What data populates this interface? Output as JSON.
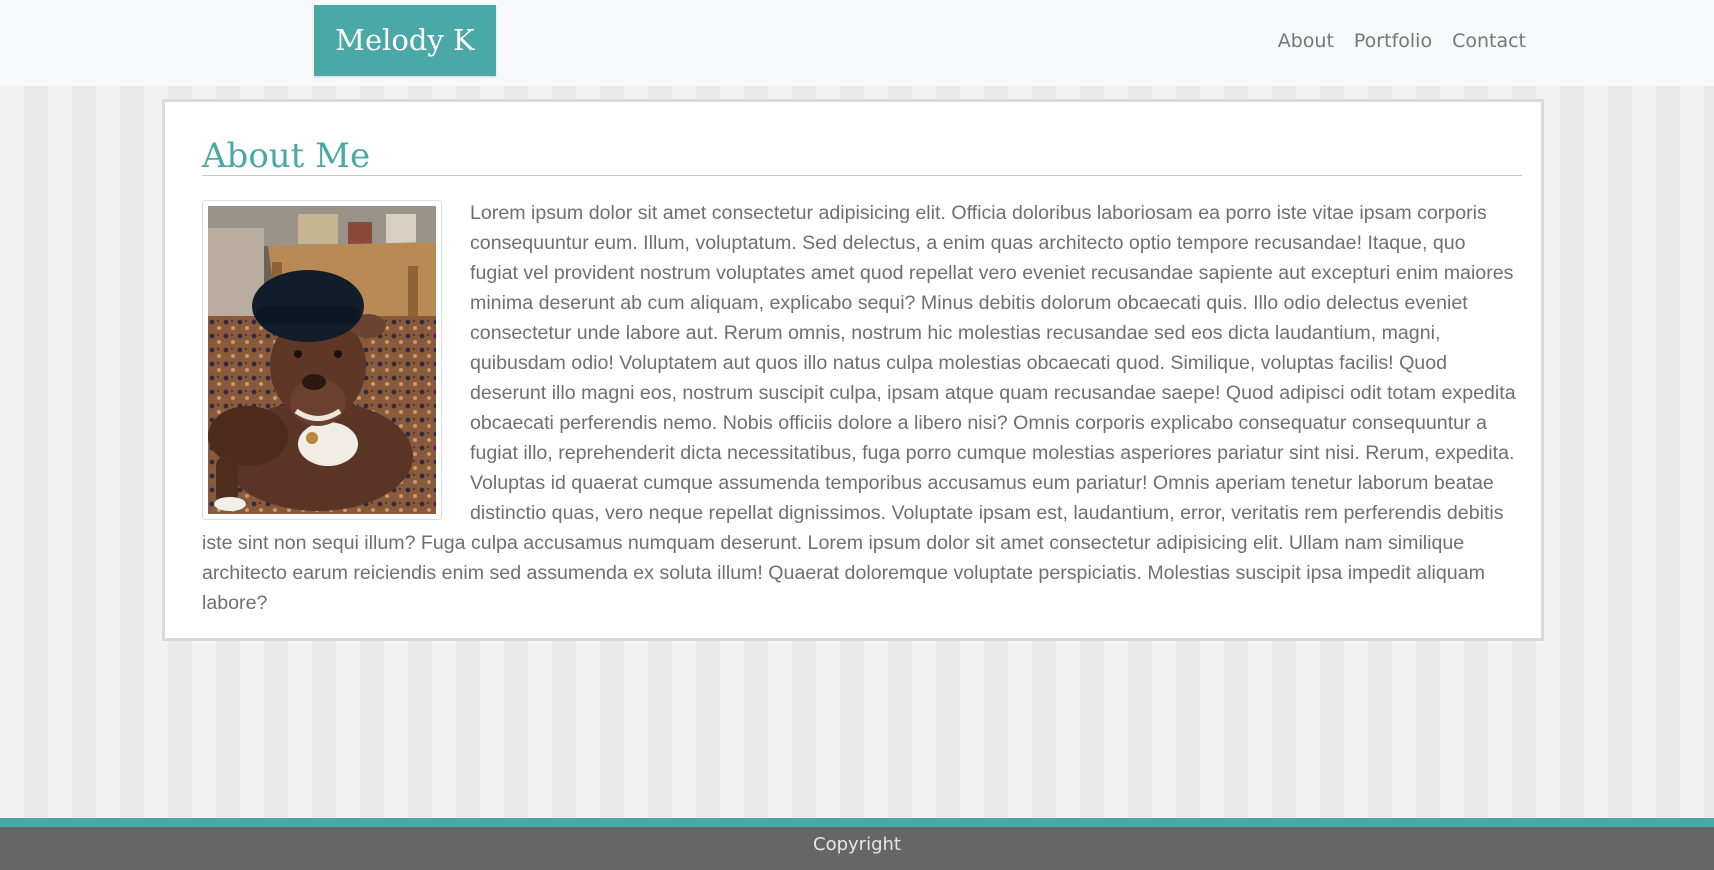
{
  "header": {
    "brand": "Melody K",
    "nav": [
      "About",
      "Portfolio",
      "Contact"
    ]
  },
  "about": {
    "title": "About Me",
    "photo_icon": "dog-photo",
    "body": "Lorem ipsum dolor sit amet consectetur adipisicing elit. Officia doloribus laboriosam ea porro iste vitae ipsam corporis consequuntur eum. Illum, voluptatum. Sed delectus, a enim quas architecto optio tempore recusandae! Itaque, quo fugiat vel provident nostrum voluptates amet quod repellat vero eveniet recusandae sapiente aut excepturi enim maiores minima deserunt ab cum aliquam, explicabo sequi? Minus debitis dolorum obcaecati quis. Illo odio delectus eveniet consectetur unde labore aut. Rerum omnis, nostrum hic molestias recusandae sed eos dicta laudantium, magni, quibusdam odio! Voluptatem aut quos illo natus culpa molestias obcaecati quod. Similique, voluptas facilis! Quod deserunt illo magni eos, nostrum suscipit culpa, ipsam atque quam recusandae saepe! Quod adipisci odit totam expedita obcaecati perferendis nemo. Nobis officiis dolore a libero nisi? Omnis corporis explicabo consequatur consequuntur a fugiat illo, reprehenderit dicta necessitatibus, fuga porro cumque molestias asperiores pariatur sint nisi. Rerum, expedita. Voluptas id quaerat cumque assumenda temporibus accusamus eum pariatur! Omnis aperiam tenetur laborum beatae distinctio quas, vero neque repellat dignissimos. Voluptate ipsam est, laudantium, error, veritatis rem perferendis debitis iste sint non sequi illum? Fuga culpa accusamus numquam deserunt. Lorem ipsum dolor sit amet consectetur adipisicing elit. Ullam nam similique architecto earum reiciendis enim sed assumenda ex soluta illum! Quaerat doloremque voluptate perspiciatis. Molestias suscipit ipsa impedit aliquam labore?"
  },
  "footer": {
    "text": "Copyright"
  },
  "colors": {
    "accent": "#4aa8a6",
    "footer": "#666666",
    "text": "#6f6f6f"
  }
}
